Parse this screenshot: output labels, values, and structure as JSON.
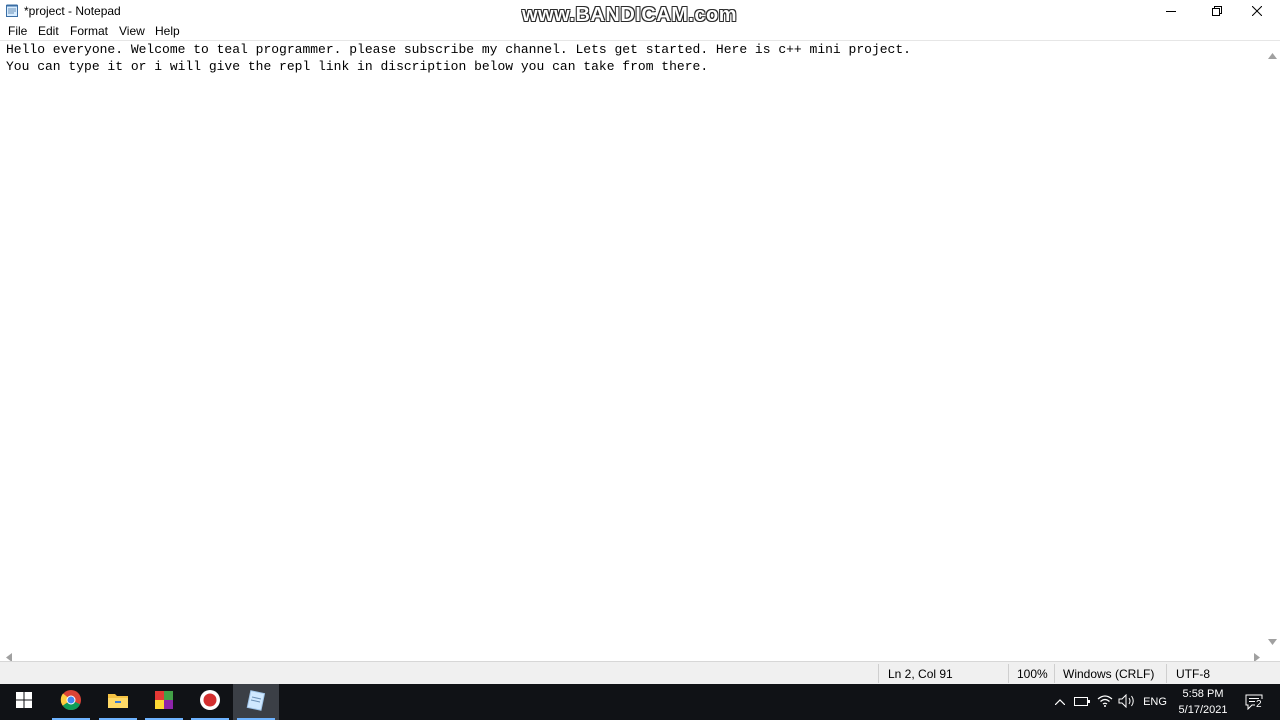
{
  "window": {
    "title": "*project - Notepad",
    "watermark": "www.BANDICAM.com"
  },
  "menu": {
    "file": "File",
    "edit": "Edit",
    "format": "Format",
    "view": "View",
    "help": "Help"
  },
  "editor": {
    "lines": [
      "Hello everyone. Welcome to teal programmer. please subscribe my channel. Lets get started. Here is c++ mini project.",
      "You can type it or i will give the repl link in discription below you can take from there."
    ]
  },
  "status": {
    "position": "Ln 2, Col 91",
    "zoom": "100%",
    "line_ending": "Windows (CRLF)",
    "encoding": "UTF-8"
  },
  "taskbar": {
    "apps": [
      "windows-start-icon",
      "chrome-icon",
      "file-explorer-icon",
      "app-icon",
      "record-icon",
      "notepad-icon"
    ],
    "language": "ENG",
    "time": "5:58 PM",
    "date": "5/17/2021",
    "notification_count": "2"
  },
  "colors": {
    "taskbar": "#101216",
    "active_task": "#3b3f46",
    "accent": "#6eb3ff",
    "statusbar": "#f0f0f0"
  }
}
